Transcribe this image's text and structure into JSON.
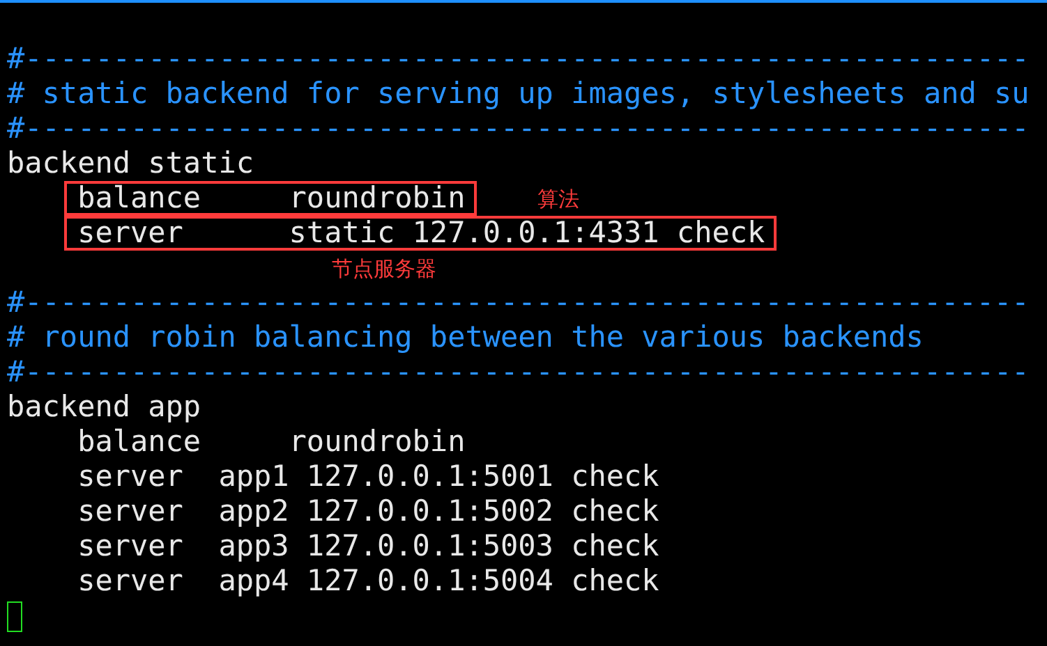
{
  "lines": [
    {
      "kind": "comment",
      "text": "#---------------------------------------------------------"
    },
    {
      "kind": "comment",
      "text": "# static backend for serving up images, stylesheets and su"
    },
    {
      "kind": "comment",
      "text": "#---------------------------------------------------------"
    },
    {
      "kind": "code",
      "indented": false,
      "text": "backend static"
    },
    {
      "kind": "code",
      "indented": true,
      "text": "balance     roundrobin",
      "boxed": true,
      "note": "算法"
    },
    {
      "kind": "code",
      "indented": true,
      "text": "server      static 127.0.0.1:4331 check",
      "boxed": true
    },
    {
      "kind": "note",
      "text": "节点服务器"
    },
    {
      "kind": "comment",
      "text": "#---------------------------------------------------------"
    },
    {
      "kind": "comment",
      "text": "# round robin balancing between the various backends"
    },
    {
      "kind": "comment",
      "text": "#---------------------------------------------------------"
    },
    {
      "kind": "code",
      "indented": false,
      "text": "backend app"
    },
    {
      "kind": "code",
      "indented": true,
      "text": "balance     roundrobin"
    },
    {
      "kind": "code",
      "indented": true,
      "text": "server  app1 127.0.0.1:5001 check"
    },
    {
      "kind": "code",
      "indented": true,
      "text": "server  app2 127.0.0.1:5002 check"
    },
    {
      "kind": "code",
      "indented": true,
      "text": "server  app3 127.0.0.1:5003 check"
    },
    {
      "kind": "code",
      "indented": true,
      "text": "server  app4 127.0.0.1:5004 check"
    }
  ]
}
